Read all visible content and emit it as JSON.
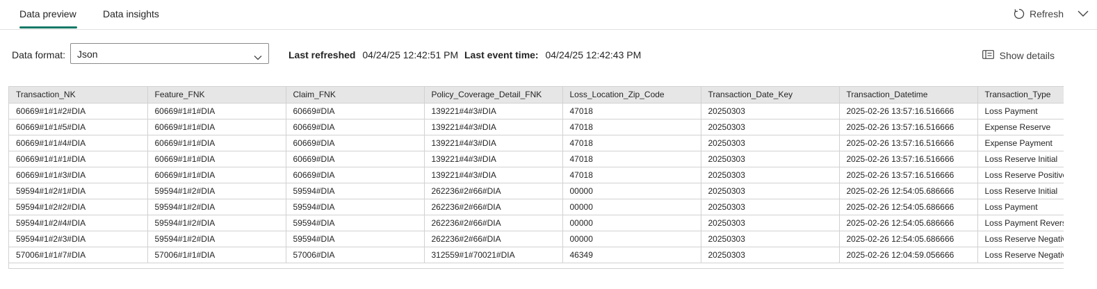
{
  "tabs": {
    "preview": "Data preview",
    "insights": "Data insights"
  },
  "header": {
    "refresh_label": "Refresh"
  },
  "toolbar": {
    "format_label": "Data format:",
    "format_value": "Json",
    "last_refreshed_label": "Last refreshed",
    "last_refreshed_value": "04/24/25 12:42:51 PM",
    "last_event_label": "Last event time:",
    "last_event_value": "04/24/25 12:42:43 PM",
    "show_details_label": "Show details"
  },
  "table": {
    "columns": [
      "Transaction_NK",
      "Feature_FNK",
      "Claim_FNK",
      "Policy_Coverage_Detail_FNK",
      "Loss_Location_Zip_Code",
      "Transaction_Date_Key",
      "Transaction_Datetime",
      "Transaction_Type"
    ],
    "rows": [
      [
        "60669#1#1#2#DIA",
        "60669#1#1#DIA",
        "60669#DIA",
        "139221#4#3#DIA",
        "47018",
        "20250303",
        "2025-02-26 13:57:16.516666",
        "Loss Payment"
      ],
      [
        "60669#1#1#5#DIA",
        "60669#1#1#DIA",
        "60669#DIA",
        "139221#4#3#DIA",
        "47018",
        "20250303",
        "2025-02-26 13:57:16.516666",
        "Expense Reserve"
      ],
      [
        "60669#1#1#4#DIA",
        "60669#1#1#DIA",
        "60669#DIA",
        "139221#4#3#DIA",
        "47018",
        "20250303",
        "2025-02-26 13:57:16.516666",
        "Expense Payment"
      ],
      [
        "60669#1#1#1#DIA",
        "60669#1#1#DIA",
        "60669#DIA",
        "139221#4#3#DIA",
        "47018",
        "20250303",
        "2025-02-26 13:57:16.516666",
        "Loss Reserve Initial"
      ],
      [
        "60669#1#1#3#DIA",
        "60669#1#1#DIA",
        "60669#DIA",
        "139221#4#3#DIA",
        "47018",
        "20250303",
        "2025-02-26 13:57:16.516666",
        "Loss Reserve Positive A"
      ],
      [
        "59594#1#2#1#DIA",
        "59594#1#2#DIA",
        "59594#DIA",
        "262236#2#66#DIA",
        "00000",
        "20250303",
        "2025-02-26 12:54:05.686666",
        "Loss Reserve Initial"
      ],
      [
        "59594#1#2#2#DIA",
        "59594#1#2#DIA",
        "59594#DIA",
        "262236#2#66#DIA",
        "00000",
        "20250303",
        "2025-02-26 12:54:05.686666",
        "Loss Payment"
      ],
      [
        "59594#1#2#4#DIA",
        "59594#1#2#DIA",
        "59594#DIA",
        "262236#2#66#DIA",
        "00000",
        "20250303",
        "2025-02-26 12:54:05.686666",
        "Loss Payment Reversal"
      ],
      [
        "59594#1#2#3#DIA",
        "59594#1#2#DIA",
        "59594#DIA",
        "262236#2#66#DIA",
        "00000",
        "20250303",
        "2025-02-26 12:54:05.686666",
        "Loss Reserve Negative"
      ],
      [
        "57006#1#1#7#DIA",
        "57006#1#1#DIA",
        "57006#DIA",
        "312559#1#70021#DIA",
        "46349",
        "20250303",
        "2025-02-26 12:04:59.056666",
        "Loss Reserve Negative"
      ]
    ]
  },
  "colors": {
    "accent": "#117865"
  }
}
